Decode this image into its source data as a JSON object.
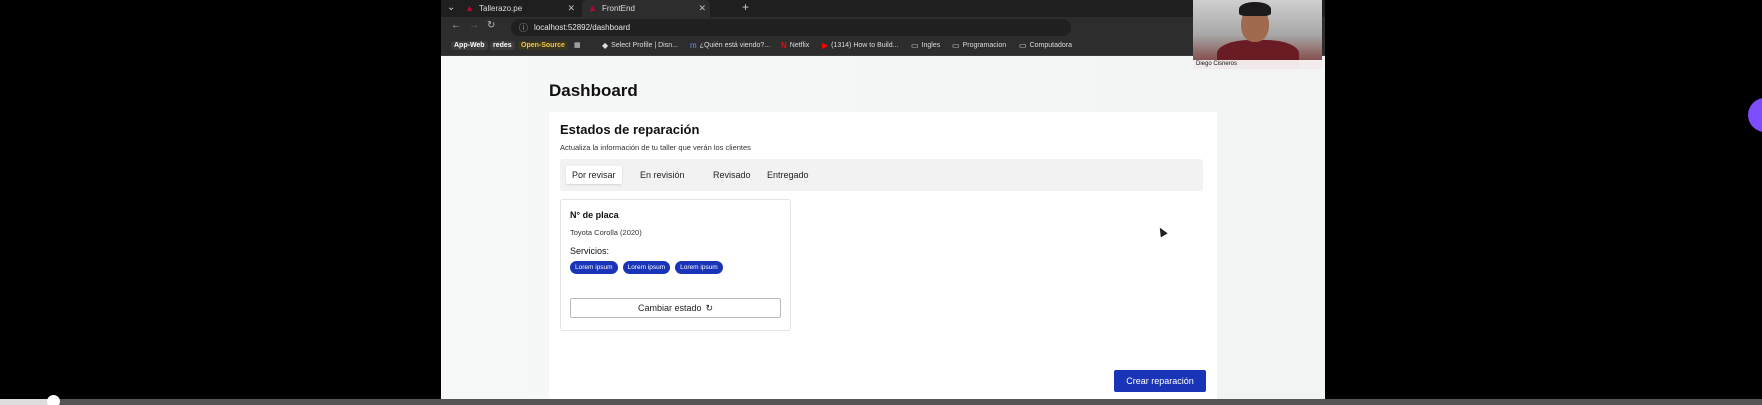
{
  "browser": {
    "tabs": [
      {
        "title": "Tallerazo.pe",
        "active": false
      },
      {
        "title": "FrontEnd",
        "active": true
      }
    ],
    "url": "localhost:52892/dashboard",
    "bookmarks": [
      {
        "label": "App-Web",
        "kind": "pill"
      },
      {
        "label": "redes",
        "kind": "pill"
      },
      {
        "label": "Open-Source",
        "kind": "pill-os"
      },
      {
        "label": "Select Profile | Disn...",
        "kind": "link"
      },
      {
        "label": "¿Quién está viendo?...",
        "kind": "link"
      },
      {
        "label": "Netflix",
        "kind": "link"
      },
      {
        "label": "(1314) How to Build...",
        "kind": "link"
      },
      {
        "label": "Ingles",
        "kind": "folder"
      },
      {
        "label": "Programacion",
        "kind": "folder"
      },
      {
        "label": "Computadora",
        "kind": "folder"
      }
    ]
  },
  "page": {
    "title": "Dashboard",
    "panel": {
      "title": "Estados de reparación",
      "subtitle": "Actualiza la información de tu taller que verán los clientes",
      "tabs": [
        {
          "label": "Por revisar",
          "active": true
        },
        {
          "label": "En revisión",
          "active": false
        },
        {
          "label": "Revisado",
          "active": false
        },
        {
          "label": "Entregado",
          "active": false
        }
      ],
      "card": {
        "title": "N° de placa",
        "car": "Toyota Corolla (2020)",
        "services_label": "Servicios:",
        "services": [
          "Lorem ipsum",
          "Lorem ipsum",
          "Lorem ipsum"
        ],
        "button": "Cambiar estado"
      },
      "create_button": "Crear reparación"
    }
  },
  "webcam": {
    "name": "Diego Cisneros"
  },
  "video": {
    "progress": 0.03
  },
  "colors": {
    "accent": "#1a34b8",
    "side_button": "#7c4dff"
  }
}
